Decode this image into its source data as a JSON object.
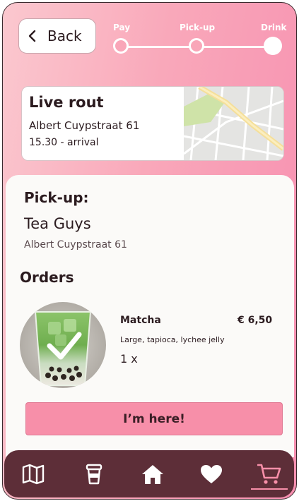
{
  "header": {
    "back_label": "Back",
    "steps": [
      {
        "label": "Pay",
        "state": "done"
      },
      {
        "label": "Pick-up",
        "state": "current"
      },
      {
        "label": "Drink",
        "state": "next"
      }
    ]
  },
  "route": {
    "title": "Live rout",
    "address": "Albert Cuypstraat 61",
    "arrival": "15.30 - arrival"
  },
  "pickup": {
    "heading": "Pick-up:",
    "shop": "Tea Guys",
    "address": "Albert Cuypstraat 61"
  },
  "orders": {
    "heading": "Orders",
    "items": [
      {
        "name": "Matcha",
        "price": "€ 6,50",
        "options": "Large, tapioca, lychee jelly",
        "quantity": "1 x",
        "status_icon": "checkmark-icon"
      }
    ]
  },
  "actions": {
    "here_label": "I’m here!"
  },
  "tabbar": {
    "items": [
      "map-icon",
      "cup-icon",
      "home-icon",
      "heart-icon",
      "cart-icon"
    ],
    "active": "cart-icon"
  },
  "colors": {
    "accent": "#f78fa9",
    "tabbar": "#5d2e38",
    "text": "#2b1b1f"
  }
}
